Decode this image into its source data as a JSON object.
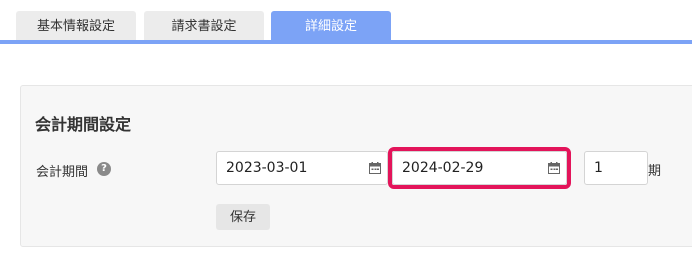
{
  "tabs": [
    {
      "label": "基本情報設定",
      "active": false
    },
    {
      "label": "請求書設定",
      "active": false
    },
    {
      "label": "詳細設定",
      "active": true
    }
  ],
  "accounting_period": {
    "section_title": "会計期間設定",
    "field_label": "会計期間",
    "help_icon": "?",
    "start_date": "2023-03-01",
    "end_date": "2024-02-29",
    "period_number": "1",
    "period_unit": "期",
    "save_label": "保存"
  },
  "colors": {
    "tab_active": "#7ca3f6",
    "highlight": "#e3145a",
    "panel_bg": "#f7f7f7"
  }
}
